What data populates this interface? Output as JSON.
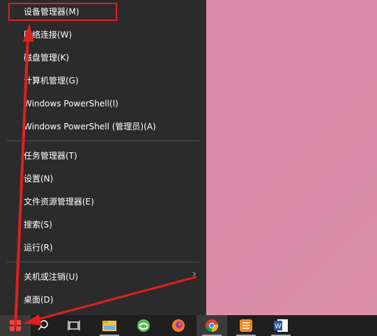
{
  "menu": {
    "items": [
      {
        "label": "设备管理器(M)"
      },
      {
        "label": "网络连接(W)"
      },
      {
        "label": "磁盘管理(K)"
      },
      {
        "label": "计算机管理(G)"
      },
      {
        "label": "Windows PowerShell(I)"
      },
      {
        "label": "Windows PowerShell (管理员)(A)"
      },
      {
        "label": "任务管理器(T)"
      },
      {
        "label": "设置(N)"
      },
      {
        "label": "文件资源管理器(E)"
      },
      {
        "label": "搜索(S)"
      },
      {
        "label": "运行(R)"
      },
      {
        "label": "关机或注销(U)"
      },
      {
        "label": "桌面(D)"
      }
    ]
  },
  "taskbar": {
    "icons": [
      "windows-start-icon",
      "search-icon",
      "task-view-icon",
      "file-explorer-icon",
      "browser-360-icon",
      "firefox-icon",
      "chrome-icon",
      "notes-app-icon",
      "word-icon"
    ]
  },
  "colors": {
    "menu_bg": "#2b2b2b",
    "desktop": "#d98aa6",
    "taskbar": "#1f1f1f",
    "annotation": "#e0201f"
  }
}
